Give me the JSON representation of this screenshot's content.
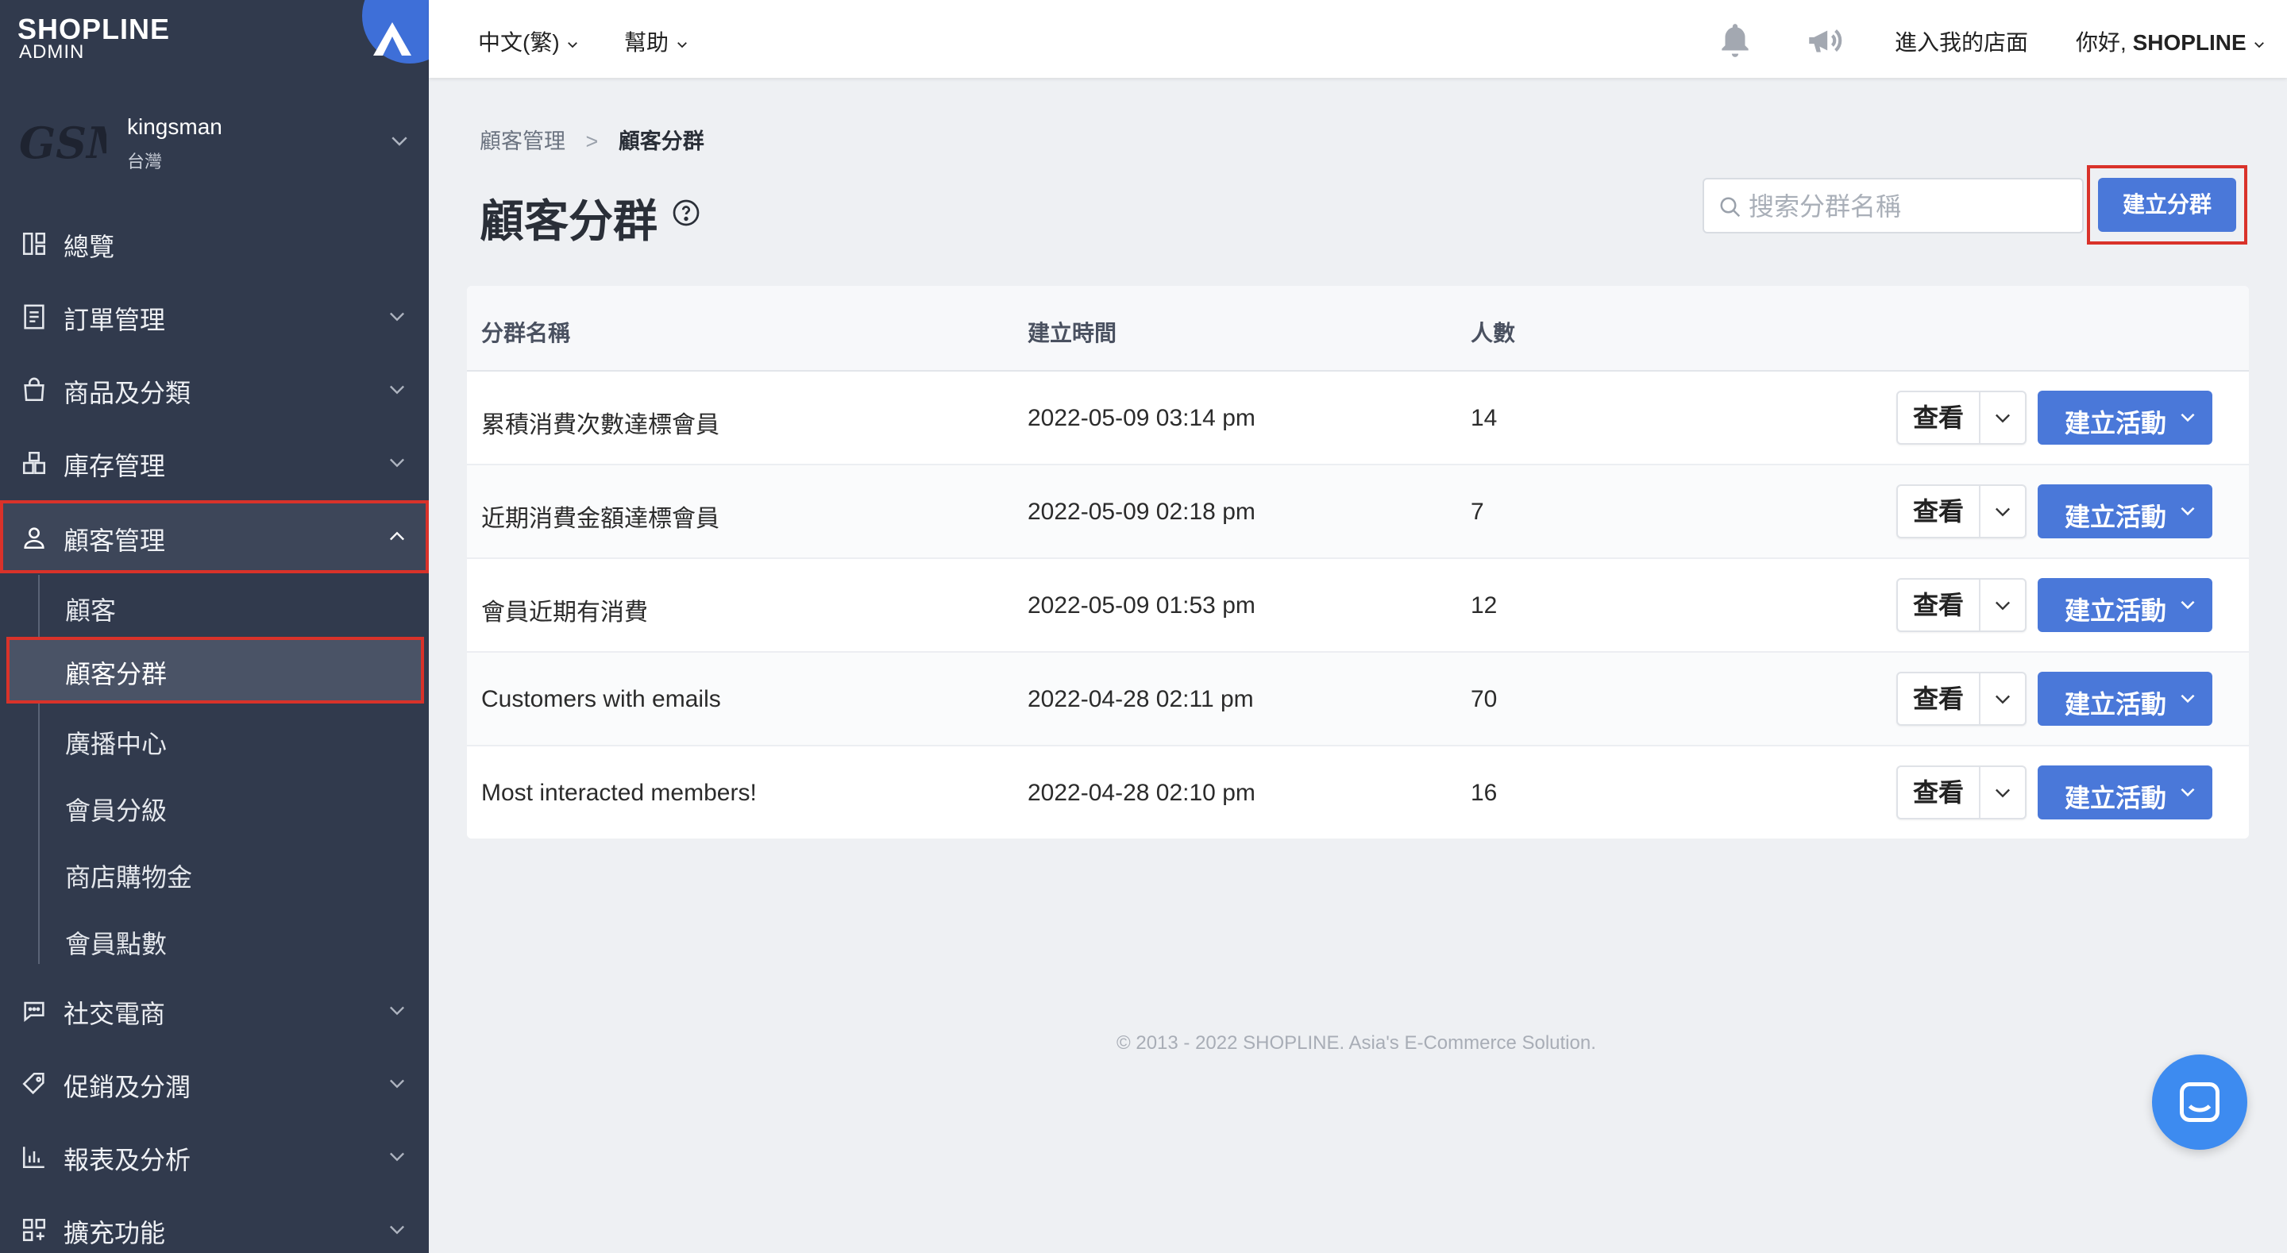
{
  "brand": {
    "name": "SHOPLINE",
    "sub": "ADMIN"
  },
  "store": {
    "mark": "GSM",
    "name": "kingsman",
    "region": "台灣"
  },
  "sidebar": {
    "items": [
      {
        "label": "總覽"
      },
      {
        "label": "訂單管理"
      },
      {
        "label": "商品及分類"
      },
      {
        "label": "庫存管理"
      },
      {
        "label": "顧客管理"
      },
      {
        "label": "社交電商"
      },
      {
        "label": "促銷及分潤"
      },
      {
        "label": "報表及分析"
      },
      {
        "label": "擴充功能"
      }
    ],
    "sub_items": [
      {
        "label": "顧客"
      },
      {
        "label": "顧客分群"
      },
      {
        "label": "廣播中心"
      },
      {
        "label": "會員分級"
      },
      {
        "label": "商店購物金"
      },
      {
        "label": "會員點數"
      }
    ]
  },
  "topbar": {
    "language": "中文(繁)",
    "help": "幫助",
    "enter_store": "進入我的店面",
    "greeting": "你好,",
    "user": "SHOPLINE"
  },
  "breadcrumb": {
    "parent": "顧客管理",
    "current": "顧客分群"
  },
  "page": {
    "title": "顧客分群"
  },
  "search": {
    "placeholder": "搜索分群名稱"
  },
  "create_button": "建立分群",
  "table": {
    "headers": {
      "name": "分群名稱",
      "created": "建立時間",
      "count": "人數"
    },
    "view_label": "查看",
    "action_label": "建立活動",
    "rows": [
      {
        "name": "累積消費次數達標會員",
        "created": "2022-05-09 03:14 pm",
        "count": "14"
      },
      {
        "name": "近期消費金額達標會員",
        "created": "2022-05-09 02:18 pm",
        "count": "7"
      },
      {
        "name": "會員近期有消費",
        "created": "2022-05-09 01:53 pm",
        "count": "12"
      },
      {
        "name": "Customers with emails",
        "created": "2022-04-28 02:11 pm",
        "count": "70"
      },
      {
        "name": "Most interacted members!",
        "created": "2022-04-28 02:10 pm",
        "count": "16"
      }
    ]
  },
  "footer": "© 2013 - 2022 SHOPLINE. Asia's E-Commerce Solution.",
  "colors": {
    "sidebar": "#313a4d",
    "accent": "#4a78d9",
    "highlight": "#d9322a",
    "chat": "#3d8bf0"
  }
}
